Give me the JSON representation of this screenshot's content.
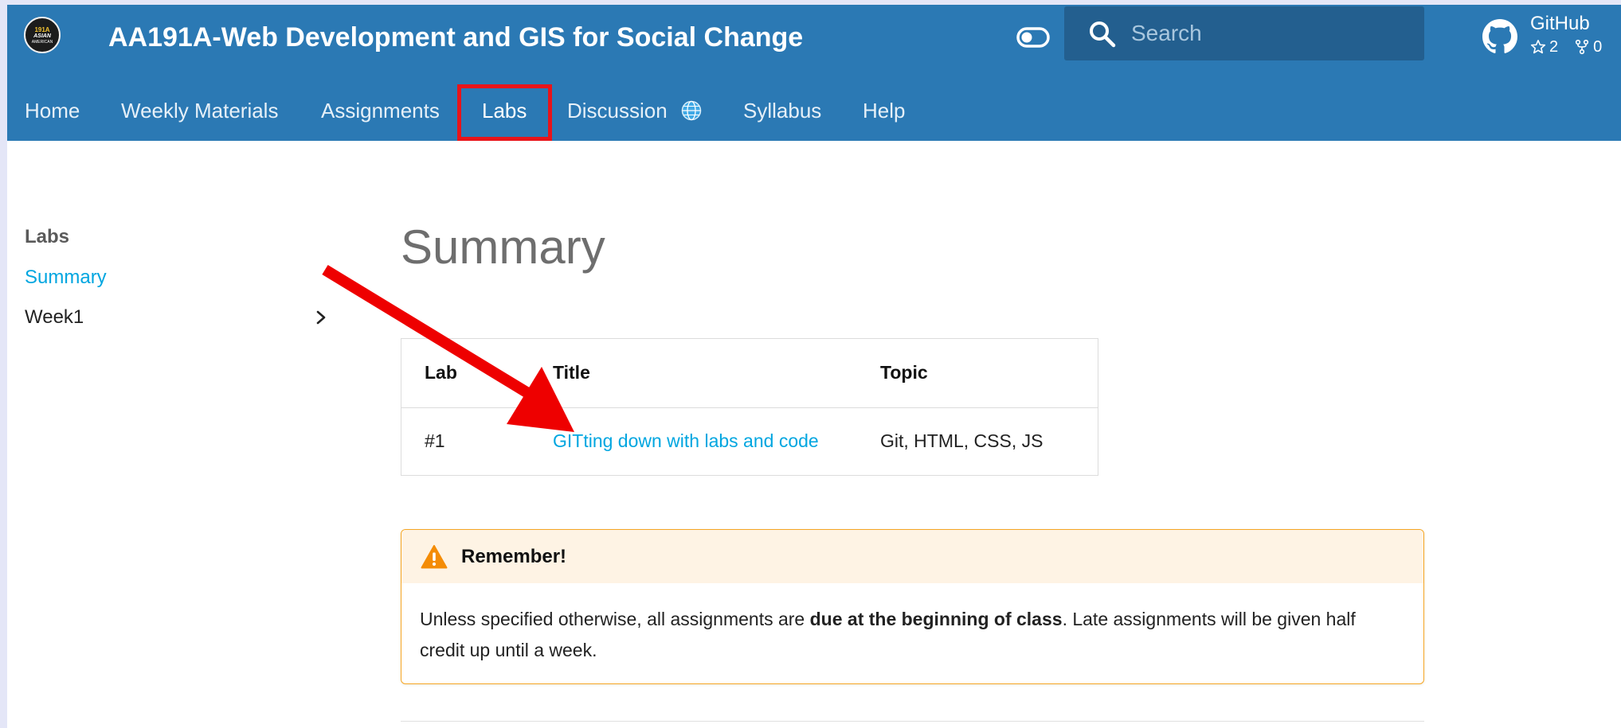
{
  "header": {
    "logo": {
      "line1": "191A",
      "line2": "ASIAN",
      "line3": "AMERICAN"
    },
    "site_title": "AA191A-Web Development and GIS for Social Change",
    "search": {
      "placeholder": "Search",
      "value": ""
    },
    "github": {
      "name": "GitHub",
      "stars": "2",
      "forks": "0"
    }
  },
  "tabs": [
    {
      "label": "Home"
    },
    {
      "label": "Weekly Materials"
    },
    {
      "label": "Assignments"
    },
    {
      "label": "Labs",
      "selected": true
    },
    {
      "label": "Discussion"
    },
    {
      "label": "Syllabus"
    },
    {
      "label": "Help"
    }
  ],
  "sidebar": {
    "heading": "Labs",
    "items": [
      {
        "label": "Summary",
        "active": true
      },
      {
        "label": "Week1"
      }
    ]
  },
  "main": {
    "title": "Summary",
    "table": {
      "headers": [
        "Lab",
        "Title",
        "Topic"
      ],
      "rows": [
        {
          "lab": "#1",
          "title": "GITting down with labs and code",
          "topic": "Git, HTML, CSS, JS"
        }
      ]
    },
    "callout": {
      "title": "Remember!",
      "body_before": "Unless specified otherwise, all assignments are ",
      "body_bold": "due at the beginning of class",
      "body_after": ". Late assignments will be given half credit up until a week."
    }
  },
  "colors": {
    "header_bg": "#2b79b4",
    "link": "#00a6e0",
    "highlight_box": "#e8141a",
    "annotation_arrow": "#ee0000",
    "callout_border": "#f6a623"
  }
}
